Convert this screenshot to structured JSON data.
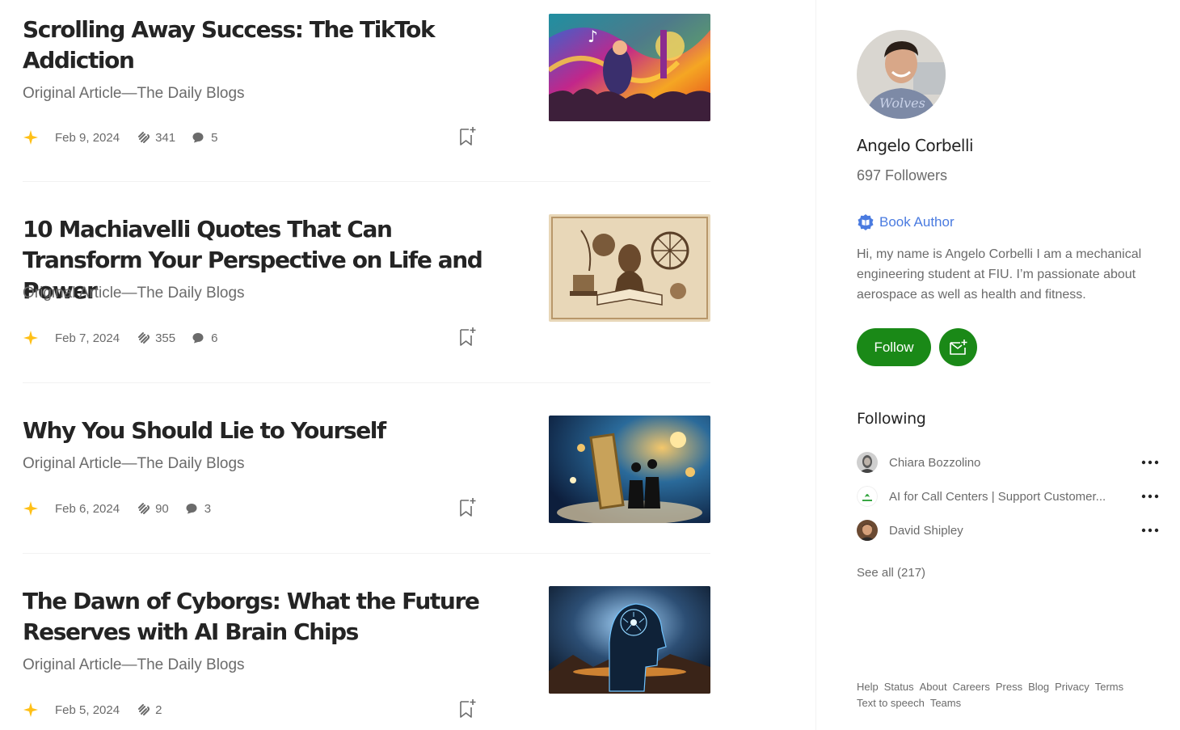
{
  "articles": [
    {
      "title": "Scrolling Away Success: The TikTok Addiction",
      "subtitle": "Original Article—The Daily Blogs",
      "date": "Feb 9, 2024",
      "claps": "341",
      "responses": "5"
    },
    {
      "title": "10 Machiavelli Quotes That Can Transform Your Perspective on Life and Power",
      "subtitle": "Original Article—The Daily Blogs",
      "date": "Feb 7, 2024",
      "claps": "355",
      "responses": "6"
    },
    {
      "title": "Why You Should Lie to Yourself",
      "subtitle": "Original Article—The Daily Blogs",
      "date": "Feb 6, 2024",
      "claps": "90",
      "responses": "3"
    },
    {
      "title": "The Dawn of Cyborgs: What the Future Reserves with AI Brain Chips",
      "subtitle": "Original Article—The Daily Blogs",
      "date": "Feb 5, 2024",
      "claps": "2",
      "responses": ""
    }
  ],
  "profile": {
    "name": "Angelo Corbelli",
    "followers": "697 Followers",
    "badge": "Book Author",
    "bio": "Hi, my name is Angelo Corbelli I am a mechanical engineering student at FIU. I’m passionate about aerospace as well as health and fitness.",
    "follow_label": "Follow"
  },
  "following": {
    "heading": "Following",
    "items": [
      {
        "name": "Chiara Bozzolino"
      },
      {
        "name": "AI for Call Centers | Support Customer..."
      },
      {
        "name": "David Shipley"
      }
    ],
    "see_all": "See all (217)"
  },
  "footer": {
    "links": [
      "Help",
      "Status",
      "About",
      "Careers",
      "Press",
      "Blog",
      "Privacy",
      "Terms",
      "Text to speech",
      "Teams"
    ]
  },
  "colors": {
    "accent_green": "#1a8917",
    "star_yellow": "#ffc017",
    "badge_blue": "#4a7be0"
  }
}
